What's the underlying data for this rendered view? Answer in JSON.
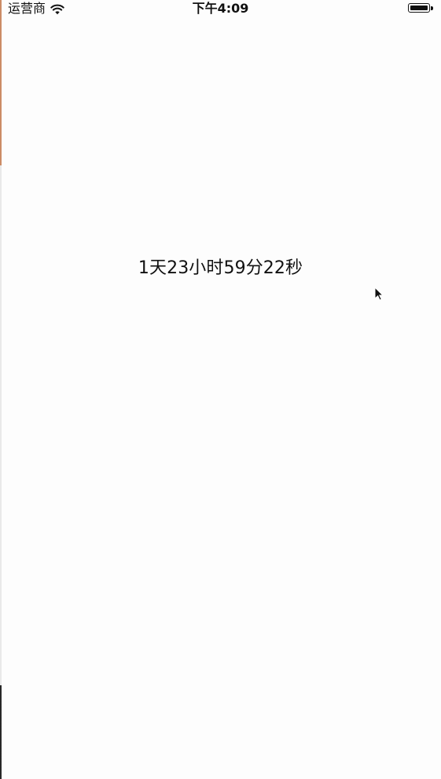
{
  "status_bar": {
    "carrier": "运营商",
    "time": "下午4:09",
    "wifi_icon": "wifi-icon",
    "battery_icon": "battery-icon"
  },
  "main": {
    "countdown_text": "1天23小时59分22秒"
  },
  "pointer": {
    "icon": "mouse-pointer-icon"
  },
  "colors": {
    "background": "#fdfdfd",
    "text": "#111111",
    "left_edge_top": "#c77f55"
  }
}
